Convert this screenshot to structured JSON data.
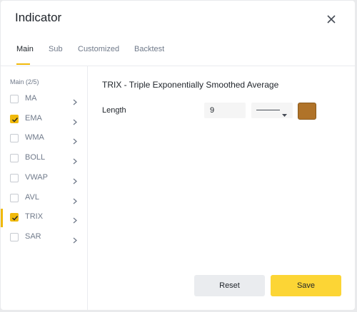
{
  "dialog": {
    "title": "Indicator",
    "close_icon": "close-icon"
  },
  "tabs": [
    {
      "label": "Main",
      "active": true
    },
    {
      "label": "Sub",
      "active": false
    },
    {
      "label": "Customized",
      "active": false
    },
    {
      "label": "Backtest",
      "active": false
    }
  ],
  "sidebar": {
    "group_label": "Main (2/5)",
    "items": [
      {
        "label": "MA",
        "checked": false,
        "active": false
      },
      {
        "label": "EMA",
        "checked": true,
        "active": false
      },
      {
        "label": "WMA",
        "checked": false,
        "active": false
      },
      {
        "label": "BOLL",
        "checked": false,
        "active": false
      },
      {
        "label": "VWAP",
        "checked": false,
        "active": false
      },
      {
        "label": "AVL",
        "checked": false,
        "active": false
      },
      {
        "label": "TRIX",
        "checked": true,
        "active": true
      },
      {
        "label": "SAR",
        "checked": false,
        "active": false
      }
    ]
  },
  "content": {
    "title": "TRIX - Triple Exponentially Smoothed Average",
    "params": [
      {
        "label": "Length",
        "value": "9",
        "line_style": "solid",
        "color": "#b07329"
      }
    ]
  },
  "buttons": {
    "reset": "Reset",
    "save": "Save"
  },
  "colors": {
    "accent": "#f0b90b",
    "save_bg": "#fcd535",
    "reset_bg": "#eaecef"
  }
}
